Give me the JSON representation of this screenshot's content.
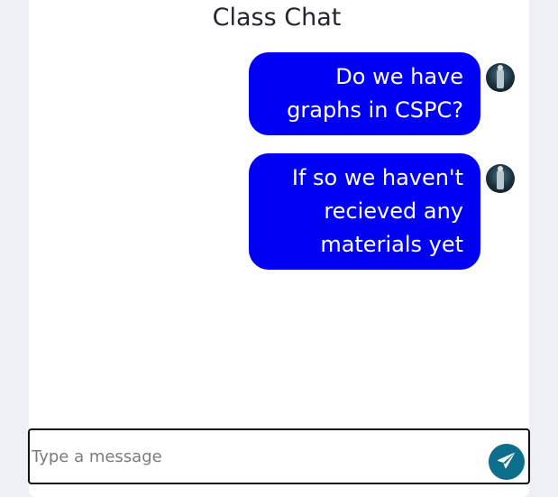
{
  "header": {
    "title": "Class Chat"
  },
  "messages": [
    {
      "text": "Do we have graphs in CSPC?",
      "sender": "self",
      "avatar_icon": "user-avatar"
    },
    {
      "text": "If so we haven't recieved any materials yet",
      "sender": "self",
      "avatar_icon": "user-avatar"
    }
  ],
  "composer": {
    "value": "",
    "placeholder": "Type a message",
    "send_icon": "paper-plane-icon"
  },
  "colors": {
    "bubble": "#0000f5",
    "send_button": "#0c6e8b",
    "page_background": "#eff0f5"
  }
}
